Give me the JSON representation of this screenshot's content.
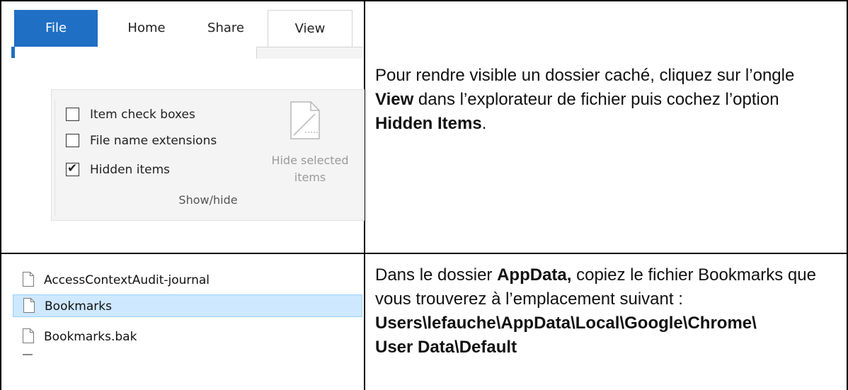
{
  "ribbon": {
    "tabs": [
      "File",
      "Home",
      "Share",
      "View"
    ],
    "group": {
      "checkboxes": [
        {
          "label": "Item check boxes",
          "checked": false
        },
        {
          "label": "File name extensions",
          "checked": false
        },
        {
          "label": "Hidden items",
          "checked": true
        }
      ],
      "hide_selected_line1": "Hide selected",
      "hide_selected_line2": "items",
      "group_label": "Show/hide"
    }
  },
  "files": [
    {
      "name": "AccessContextAudit-journal",
      "selected": false
    },
    {
      "name": "Bookmarks",
      "selected": true
    },
    {
      "name": "Bookmarks.bak",
      "selected": false
    }
  ],
  "instructions": {
    "p1_a": "Pour rendre visible un dossier caché, cliquez sur l’ongle ",
    "p1_b": "View",
    "p1_c": " dans l’explorateur de fichier puis cochez l’option ",
    "p1_d": "Hidden Items",
    "p1_e": ".",
    "p2_a": "Dans le dossier ",
    "p2_b": "AppData,",
    "p2_c": " copiez le fichier Bookmarks que vous trouverez à l’emplacement suivant :",
    "p2_path_1": "Users\\lefauche\\AppData\\Local\\Google\\Chrome\\",
    "p2_path_2": "User Data\\Default"
  },
  "colors": {
    "file_tab": "#1f6fc5",
    "selection": "#cde8ff"
  }
}
